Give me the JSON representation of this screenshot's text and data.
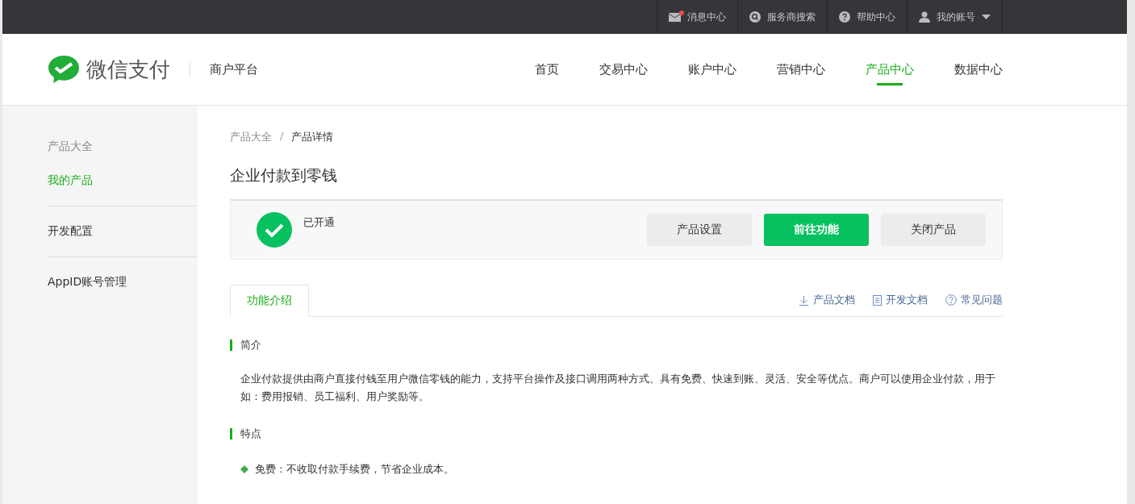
{
  "top_bar": {
    "items": [
      {
        "kind": "message",
        "label": "消息中心",
        "unread": true
      },
      {
        "kind": "search",
        "label": "服务商搜索",
        "unread": false
      },
      {
        "kind": "help",
        "label": "帮助中心",
        "unread": false
      },
      {
        "kind": "account",
        "label": "我的账号",
        "unread": false
      }
    ]
  },
  "header": {
    "brand": "微信支付",
    "subtitle": "商户平台",
    "nav": [
      {
        "label": "首页",
        "selected": false
      },
      {
        "label": "交易中心",
        "selected": false
      },
      {
        "label": "账户中心",
        "selected": false
      },
      {
        "label": "营销中心",
        "selected": false
      },
      {
        "label": "产品中心",
        "selected": true
      },
      {
        "label": "数据中心",
        "selected": false
      }
    ]
  },
  "sidebar": {
    "groups": [
      {
        "items": [
          {
            "label": "产品大全",
            "selected": false
          },
          {
            "label": "我的产品",
            "selected": true
          }
        ]
      },
      {
        "items": [
          {
            "label": "开发配置",
            "selected": false
          }
        ]
      },
      {
        "items": [
          {
            "label": "AppID账号管理",
            "selected": false
          }
        ]
      }
    ]
  },
  "breadcrumb": [
    "产品大全",
    "产品详情"
  ],
  "breadcrumb_separator": "/",
  "title": "企业付款到零钱",
  "status_card": {
    "enabled": true,
    "status": "已开通",
    "buttons": [
      {
        "label": "产品设置",
        "kind": "default"
      },
      {
        "label": "前往功能",
        "kind": "primary"
      },
      {
        "label": "关闭产品",
        "kind": "default"
      }
    ]
  },
  "tabs": [
    {
      "label": "功能介绍",
      "selected": true
    }
  ],
  "doc_links": [
    {
      "kind": "download",
      "label": "产品文档"
    },
    {
      "kind": "doc",
      "label": "开发文档"
    },
    {
      "kind": "faq",
      "label": "常见问题"
    }
  ],
  "sections": [
    {
      "heading": "简介",
      "paragraphs": [
        "企业付款提供由商户直接付钱至用户微信零钱的能力，支持平台操作及接口调用两种方式。具有免费、快速到账、灵活、安全等优点。商户可以使用企业付款，用于如：费用报销、员工福利、用户奖励等。"
      ]
    },
    {
      "heading": "特点",
      "bullets": [
        "免费：不收取付款手续费，节省企业成本。"
      ]
    }
  ]
}
